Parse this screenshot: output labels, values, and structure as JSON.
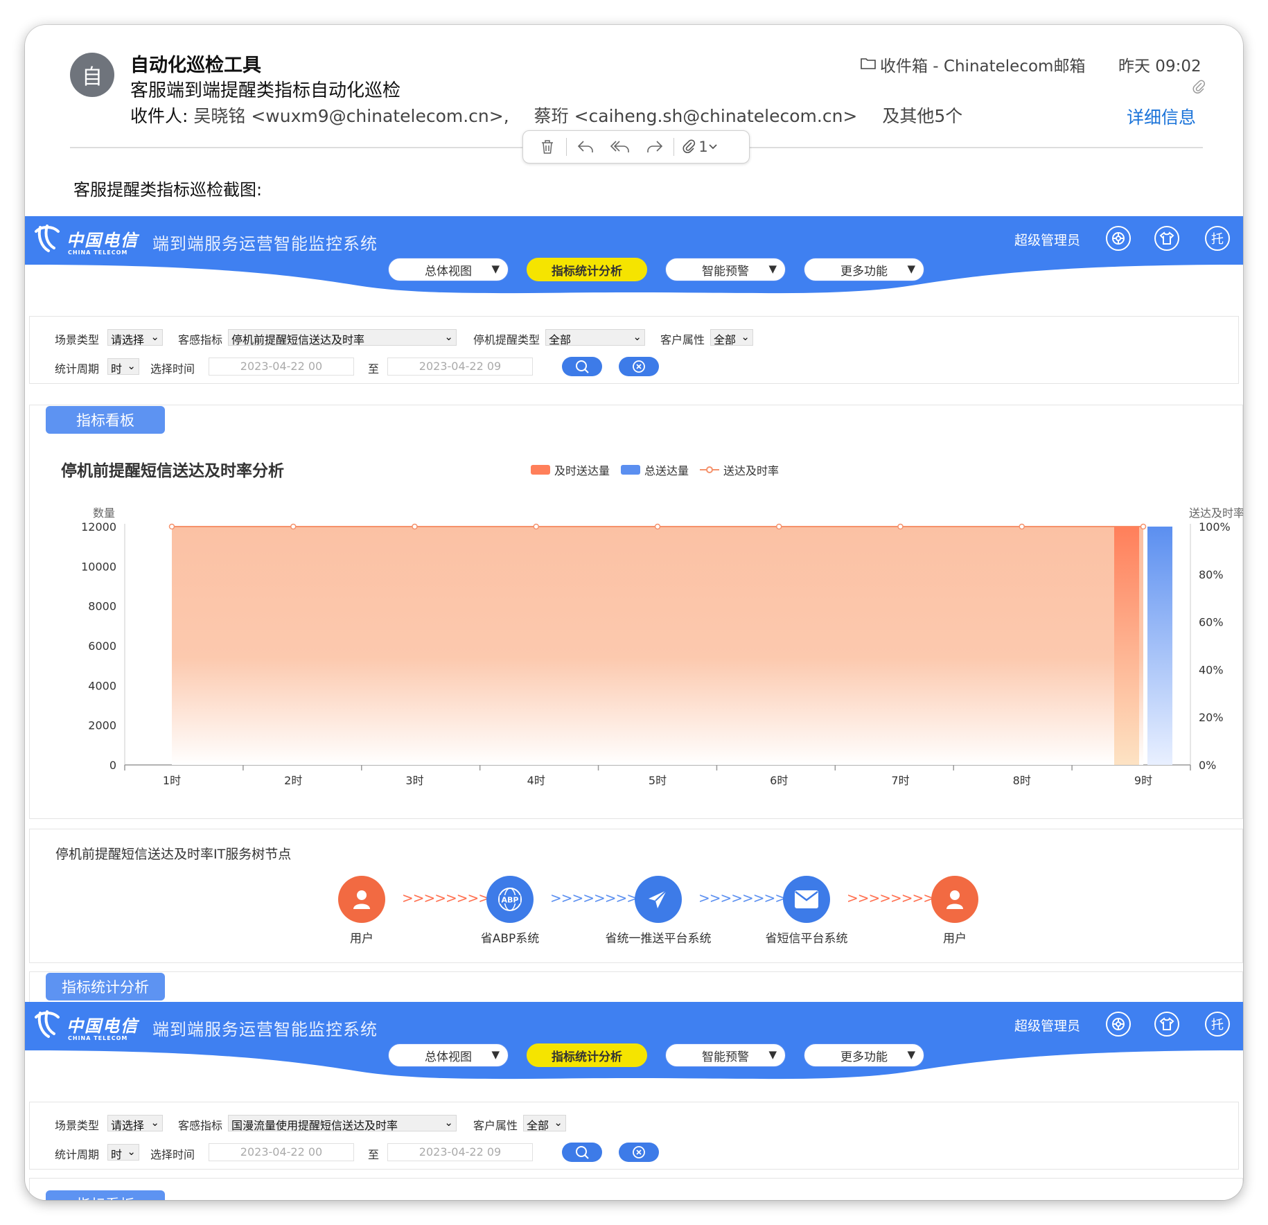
{
  "mail": {
    "avatar_char": "自",
    "sender": "自动化巡检工具",
    "subject": "客服端到端提醒类指标自动化巡检",
    "recipients_label": "收件人:",
    "recipient_1": "吴晓铭 <wuxm9@chinatelecom.cn>,",
    "recipient_2": "蔡珩 <caiheng.sh@chinatelecom.cn>",
    "recipients_more": "及其他5个",
    "folder": "收件箱 - Chinatelecom邮箱",
    "time": "昨天 09:02",
    "details_link": "详细信息",
    "attachment_count": "1",
    "body_label": "客服提醒类指标巡检截图:"
  },
  "app": {
    "brand_cn": "中国电信",
    "brand_en": "CHINA TELECOM",
    "system_title": "端到端服务运营智能监控系统",
    "admin_label": "超级管理员",
    "header_icons": [
      "settings-ring-icon",
      "shirt-icon",
      "托"
    ],
    "nav": [
      {
        "label": "总体视图",
        "active": false
      },
      {
        "label": "指标统计分析",
        "active": true
      },
      {
        "label": "智能预警",
        "active": false
      },
      {
        "label": "更多功能",
        "active": false
      }
    ],
    "nav_caret": "▼"
  },
  "filter1": {
    "scene_label": "场景类型",
    "scene_value": "请选择",
    "kpi_label": "客感指标",
    "kpi_value": "停机前提醒短信送达及时率",
    "remind_label": "停机提醒类型",
    "remind_value": "全部",
    "cust_label": "客户属性",
    "cust_value": "全部",
    "period_label": "统计周期",
    "period_value": "时",
    "time_label": "选择时间",
    "start": "2023-04-22 00",
    "to": "至",
    "end": "2023-04-22 09"
  },
  "board_tab": "指标看板",
  "chart_data": {
    "type": "bar",
    "title": "停机前提醒短信送达及时率分析",
    "categories": [
      "1时",
      "2时",
      "3时",
      "4时",
      "5时",
      "6时",
      "7时",
      "8时",
      "9时"
    ],
    "series": [
      {
        "name": "及时送达量",
        "values": [
          0,
          0,
          0,
          0,
          0,
          0,
          0,
          0,
          12000
        ],
        "color": "#ff7f5a"
      },
      {
        "name": "总送达量",
        "values": [
          0,
          0,
          0,
          0,
          0,
          0,
          0,
          0,
          12000
        ],
        "color": "#5b8ff0"
      },
      {
        "name": "送达及时率",
        "type": "line-area",
        "values": [
          100,
          100,
          100,
          100,
          100,
          100,
          100,
          100,
          100
        ],
        "color": "#f5916b"
      }
    ],
    "ylabel": "数量",
    "y2label": "送达及时率",
    "ylim": [
      0,
      12000
    ],
    "y2lim": [
      0,
      100
    ],
    "yticks": [
      "12000",
      "10000",
      "8000",
      "6000",
      "4000",
      "2000",
      "0"
    ],
    "y2ticks": [
      "100%",
      "80%",
      "60%",
      "40%",
      "20%",
      "0%"
    ]
  },
  "flow": {
    "title": "停机前提醒短信送达及时率IT服务树节点",
    "nodes": [
      {
        "label": "用户",
        "icon": "user-icon",
        "color": "#f26a42"
      },
      {
        "label": "省ABP系统",
        "icon": "abp-icon",
        "color": "#3d7be8"
      },
      {
        "label": "省统一推送平台系统",
        "icon": "send-icon",
        "color": "#3d7be8"
      },
      {
        "label": "省短信平台系统",
        "icon": "mail-icon",
        "color": "#3d7be8"
      },
      {
        "label": "用户",
        "icon": "user-icon",
        "color": "#f26a42"
      }
    ],
    "arrows": ">>>>>>>>>"
  },
  "stats_tab": "指标统计分析",
  "filter2": {
    "scene_label": "场景类型",
    "scene_value": "请选择",
    "kpi_label": "客感指标",
    "kpi_value": "国漫流量使用提醒短信送达及时率",
    "cust_label": "客户属性",
    "cust_value": "全部",
    "period_label": "统计周期",
    "period_value": "时",
    "time_label": "选择时间",
    "start": "2023-04-22 00",
    "to": "至",
    "end": "2023-04-22 09"
  },
  "board_tab_2": "指标看板"
}
